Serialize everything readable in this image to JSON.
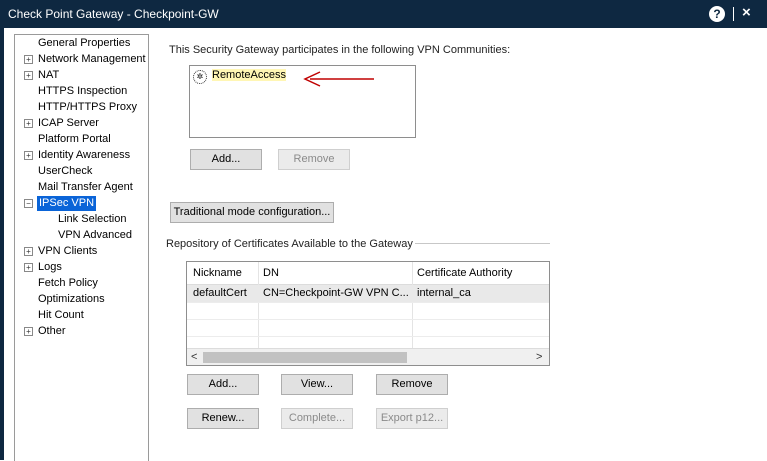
{
  "window": {
    "title": "Check Point Gateway - Checkpoint-GW",
    "help_glyph": "?",
    "close_glyph": "×"
  },
  "tree": {
    "items": [
      {
        "label": "General Properties"
      },
      {
        "label": "Network Management"
      },
      {
        "label": "NAT"
      },
      {
        "label": "HTTPS Inspection"
      },
      {
        "label": "HTTP/HTTPS Proxy"
      },
      {
        "label": "ICAP Server"
      },
      {
        "label": "Platform Portal"
      },
      {
        "label": "Identity Awareness"
      },
      {
        "label": "UserCheck"
      },
      {
        "label": "Mail Transfer Agent"
      },
      {
        "label": "IPSec VPN",
        "selected": true
      },
      {
        "label": "Link Selection"
      },
      {
        "label": "VPN Advanced"
      },
      {
        "label": "VPN Clients"
      },
      {
        "label": "Logs"
      },
      {
        "label": "Fetch Policy"
      },
      {
        "label": "Optimizations"
      },
      {
        "label": "Hit Count"
      },
      {
        "label": "Other"
      }
    ]
  },
  "communities": {
    "heading": "This Security Gateway participates in the following VPN Communities:",
    "items": [
      {
        "label": "RemoteAccess"
      }
    ],
    "add_label": "Add...",
    "remove_label": "Remove"
  },
  "traditional_mode_label": "Traditional mode configuration...",
  "certificates": {
    "heading": "Repository of Certificates Available to the Gateway",
    "columns": [
      "Nickname",
      "DN",
      "Certificate Authority"
    ],
    "rows": [
      [
        "defaultCert",
        "CN=Checkpoint-GW VPN C...",
        "internal_ca"
      ]
    ],
    "scroll_left": "<",
    "scroll_right": ">",
    "buttons": {
      "add": "Add...",
      "view": "View...",
      "remove": "Remove",
      "renew": "Renew...",
      "complete": "Complete...",
      "export": "Export p12..."
    }
  },
  "colors": {
    "titlebar": "#0e2841",
    "selection": "#0a64d8",
    "arrow": "#c00000"
  }
}
